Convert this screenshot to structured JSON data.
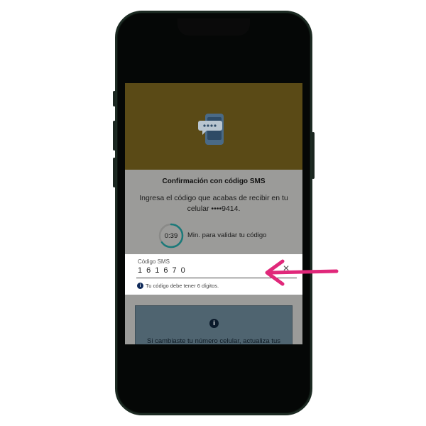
{
  "phone": {
    "frame_color": "#1d2b23"
  },
  "header": {
    "icon": "sms-message-icon",
    "background": "#5a4a16"
  },
  "confirmation": {
    "title": "Confirmación con código SMS",
    "description": "Ingresa el código que acabas de recibir en tu celular ••••9414.",
    "timer": {
      "value": "0:39",
      "label": "Min. para validar tu código",
      "progress": 0.65,
      "ring_color": "#1b7a7a"
    }
  },
  "sms_field": {
    "label": "Código SMS",
    "value": "161670",
    "hint": "Tu código debe tener 6 dígitos.",
    "hint_icon": "info-icon",
    "clear_icon": "clear-icon"
  },
  "info_card": {
    "icon": "info-icon",
    "text": "Si cambiaste tu número celular, actualiza tus"
  },
  "annotation": {
    "icon": "arrow-left-icon",
    "color": "#e0287a"
  }
}
